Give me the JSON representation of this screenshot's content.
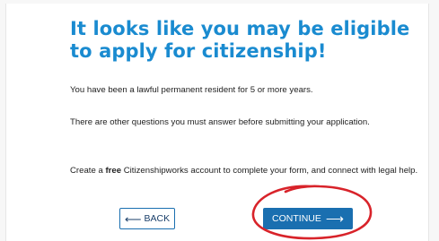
{
  "headline": "It looks like you may be eligible to apply for citizenship!",
  "paragraphs": {
    "p1": "You have been a lawful permanent resident for 5 or more years.",
    "p2": "There are other questions you must answer before submitting your application.",
    "p3_before": "Create a ",
    "p3_bold": "free",
    "p3_after": " Citizenshipworks account to complete your form, and connect with legal help."
  },
  "buttons": {
    "back_label": "BACK",
    "back_icon": "arrow-left-icon",
    "continue_label": "CONTINUE",
    "continue_icon": "arrow-right-icon"
  },
  "colors": {
    "headline": "#1a8bd0",
    "primary_button": "#1a6fb0",
    "annotation": "#d8232a"
  },
  "annotation": {
    "icon": "hand-drawn-circle-icon"
  }
}
